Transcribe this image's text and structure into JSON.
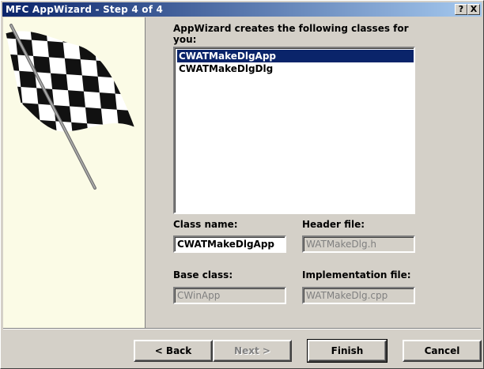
{
  "window": {
    "title": "MFC AppWizard - Step 4 of 4",
    "help_button": "?",
    "close_button": "X"
  },
  "main": {
    "classes_label_line1": "AppWizard creates the following classes for",
    "classes_label_line2": "you:",
    "classes_list": [
      {
        "name": "CWATMakeDlgApp",
        "selected": true
      },
      {
        "name": "CWATMakeDlgDlg",
        "selected": false
      }
    ],
    "class_name_label": "Class name:",
    "class_name_value": "CWATMakeDlgApp",
    "header_file_label": "Header file:",
    "header_file_value": "WATMakeDlg.h",
    "base_class_label": "Base class:",
    "base_class_value": "CWinApp",
    "implementation_file_label": "Implementation file:",
    "implementation_file_value": "WATMakeDlg.cpp"
  },
  "buttons": {
    "back": "< Back",
    "next": "Next >",
    "finish": "Finish",
    "cancel": "Cancel"
  },
  "colors": {
    "titlebar_start": "#0a246a",
    "titlebar_end": "#a6caf0",
    "selection": "#0a246a",
    "face": "#d4d0c8",
    "art_bg": "#fbfbe6"
  }
}
